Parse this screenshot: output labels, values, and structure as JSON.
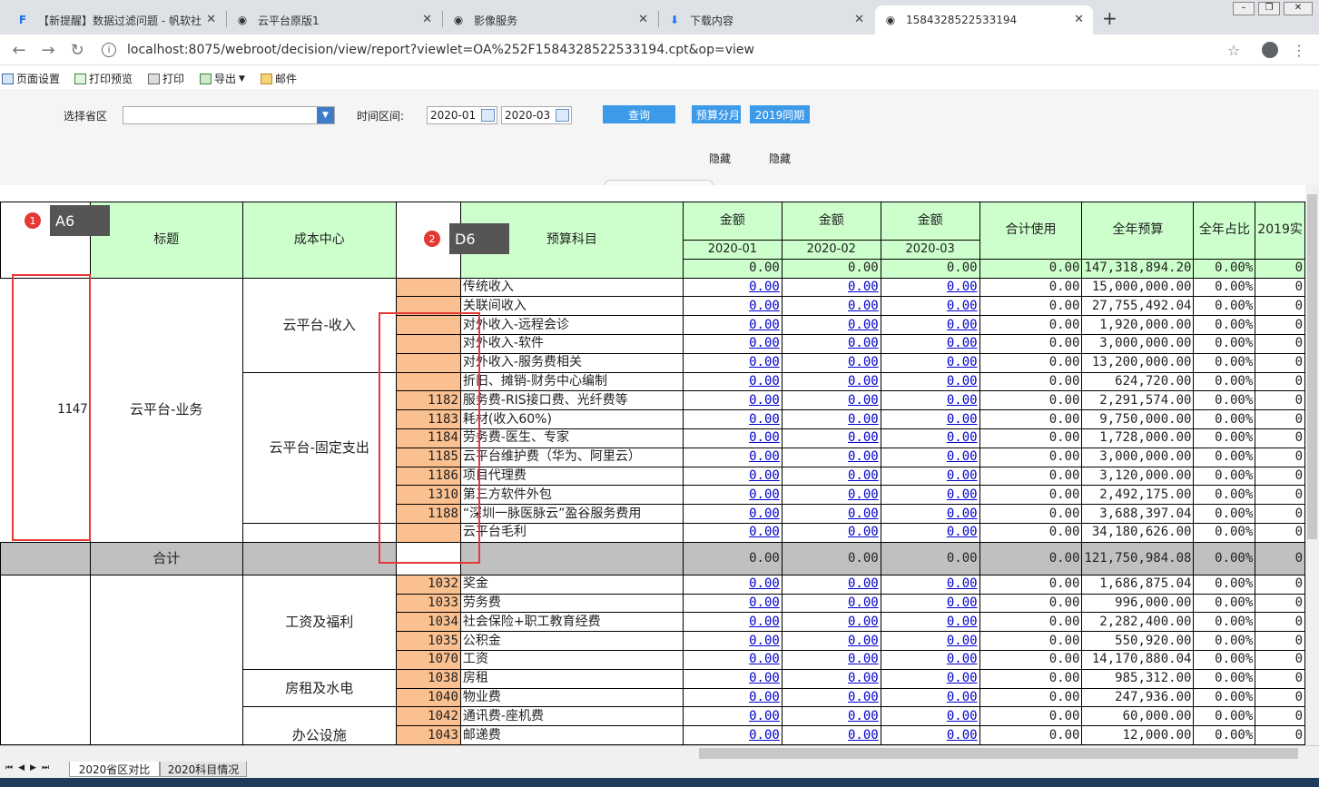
{
  "browser": {
    "tabs": [
      {
        "label": "【新提醒】数据过滤问题 - 帆软社",
        "icon": "finereport-icon"
      },
      {
        "label": "云平台原版1",
        "icon": "globe-icon"
      },
      {
        "label": "影像服务",
        "icon": "globe-icon"
      },
      {
        "label": "下载内容",
        "icon": "download-icon"
      },
      {
        "label": "1584328522533194",
        "icon": "globe-icon"
      }
    ],
    "new_tab": "+",
    "url": "localhost:8075/webroot/decision/view/report?viewlet=OA%252F1584328522533194.cpt&op=view"
  },
  "toolbar": {
    "page_setup": "页面设置",
    "print_preview": "打印预览",
    "print": "打印",
    "export": "导出",
    "mail": "邮件"
  },
  "filter": {
    "province_label": "选择省区",
    "province_value": "",
    "period_label": "时间区间:",
    "date_from": "2020-01",
    "date_to": "2020-03",
    "query": "查询",
    "budget_split": "预算分月",
    "same_period": "2019同期",
    "hide1": "隐藏",
    "hide2": "隐藏"
  },
  "annotations": {
    "badge1": "1",
    "tag1": "A6",
    "badge2": "2",
    "tag2": "D6"
  },
  "report": {
    "headers": {
      "title": "标题",
      "cost_center": "成本中心",
      "subject": "预算科目",
      "amount": "金额",
      "months": [
        "2020-01",
        "2020-02",
        "2020-03"
      ],
      "total_used": "合计使用",
      "annual_budget": "全年预算",
      "annual_ratio": "全年占比",
      "prev_year": "2019实"
    },
    "header_totals": {
      "m1": "0.00",
      "m2": "0.00",
      "m3": "0.00",
      "used": "0.00",
      "budget": "147,318,894.20",
      "ratio": "0.00%",
      "prev": "0"
    },
    "group1": {
      "id": "1147",
      "title": "云平台-业务",
      "centers": [
        "云平台-收入",
        "云平台-固定支出"
      ],
      "rows": [
        {
          "code": "",
          "subject": "传统收入",
          "budget": "15,000,000.00"
        },
        {
          "code": "",
          "subject": "关联间收入",
          "budget": "27,755,492.04"
        },
        {
          "code": "",
          "subject": "对外收入-远程会诊",
          "budget": "1,920,000.00"
        },
        {
          "code": "",
          "subject": "对外收入-软件",
          "budget": "3,000,000.00"
        },
        {
          "code": "",
          "subject": "对外收入-服务费相关",
          "budget": "13,200,000.00"
        },
        {
          "code": "",
          "subject": "折旧、摊销-财务中心编制",
          "budget": "624,720.00"
        },
        {
          "code": "1182",
          "subject": "服务费-RIS接口费、光纤费等",
          "budget": "2,291,574.00"
        },
        {
          "code": "1183",
          "subject": "耗材(收入60%)",
          "budget": "9,750,000.00"
        },
        {
          "code": "1184",
          "subject": "劳务费-医生、专家",
          "budget": "1,728,000.00"
        },
        {
          "code": "1185",
          "subject": "云平台维护费（华为、阿里云）",
          "budget": "3,000,000.00"
        },
        {
          "code": "1186",
          "subject": "项目代理费",
          "budget": "3,120,000.00"
        },
        {
          "code": "1310",
          "subject": "第三方软件外包",
          "budget": "2,492,175.00"
        },
        {
          "code": "1188",
          "subject": "“深圳一脉医脉云”盈谷服务费用",
          "budget": "3,688,397.04"
        },
        {
          "code": "",
          "subject": "云平台毛利",
          "budget": "34,180,626.00"
        }
      ]
    },
    "subtotal": {
      "label": "合计",
      "m1": "0.00",
      "m2": "0.00",
      "m3": "0.00",
      "used": "0.00",
      "budget": "121,750,984.08",
      "ratio": "0.00%",
      "prev": "0"
    },
    "group2": {
      "centers": [
        "工资及福利",
        "房租及水电",
        "办公设施"
      ],
      "rows": [
        {
          "code": "1032",
          "subject": "奖金",
          "budget": "1,686,875.04"
        },
        {
          "code": "1033",
          "subject": "劳务费",
          "budget": "996,000.00"
        },
        {
          "code": "1034",
          "subject": "社会保险+职工教育经费",
          "budget": "2,282,400.00"
        },
        {
          "code": "1035",
          "subject": "公积金",
          "budget": "550,920.00"
        },
        {
          "code": "1070",
          "subject": "工资",
          "budget": "14,170,880.04"
        },
        {
          "code": "1038",
          "subject": "房租",
          "budget": "985,312.00"
        },
        {
          "code": "1040",
          "subject": "物业费",
          "budget": "247,936.00"
        },
        {
          "code": "1042",
          "subject": "通讯费-座机费",
          "budget": "60,000.00"
        },
        {
          "code": "1043",
          "subject": "邮递费",
          "budget": "12,000.00"
        }
      ]
    },
    "cell_zero": "0.00",
    "ratio_zero": "0.00%",
    "prev_zero": "0"
  },
  "sheets": [
    "2020省区对比",
    "2020科目情况"
  ],
  "colors": {
    "header_green": "#ccffcc",
    "code_orange": "#fac090",
    "subtotal_gray": "#c0c0c0",
    "button_blue": "#3d9ae8",
    "annotation_red": "#e53935"
  }
}
